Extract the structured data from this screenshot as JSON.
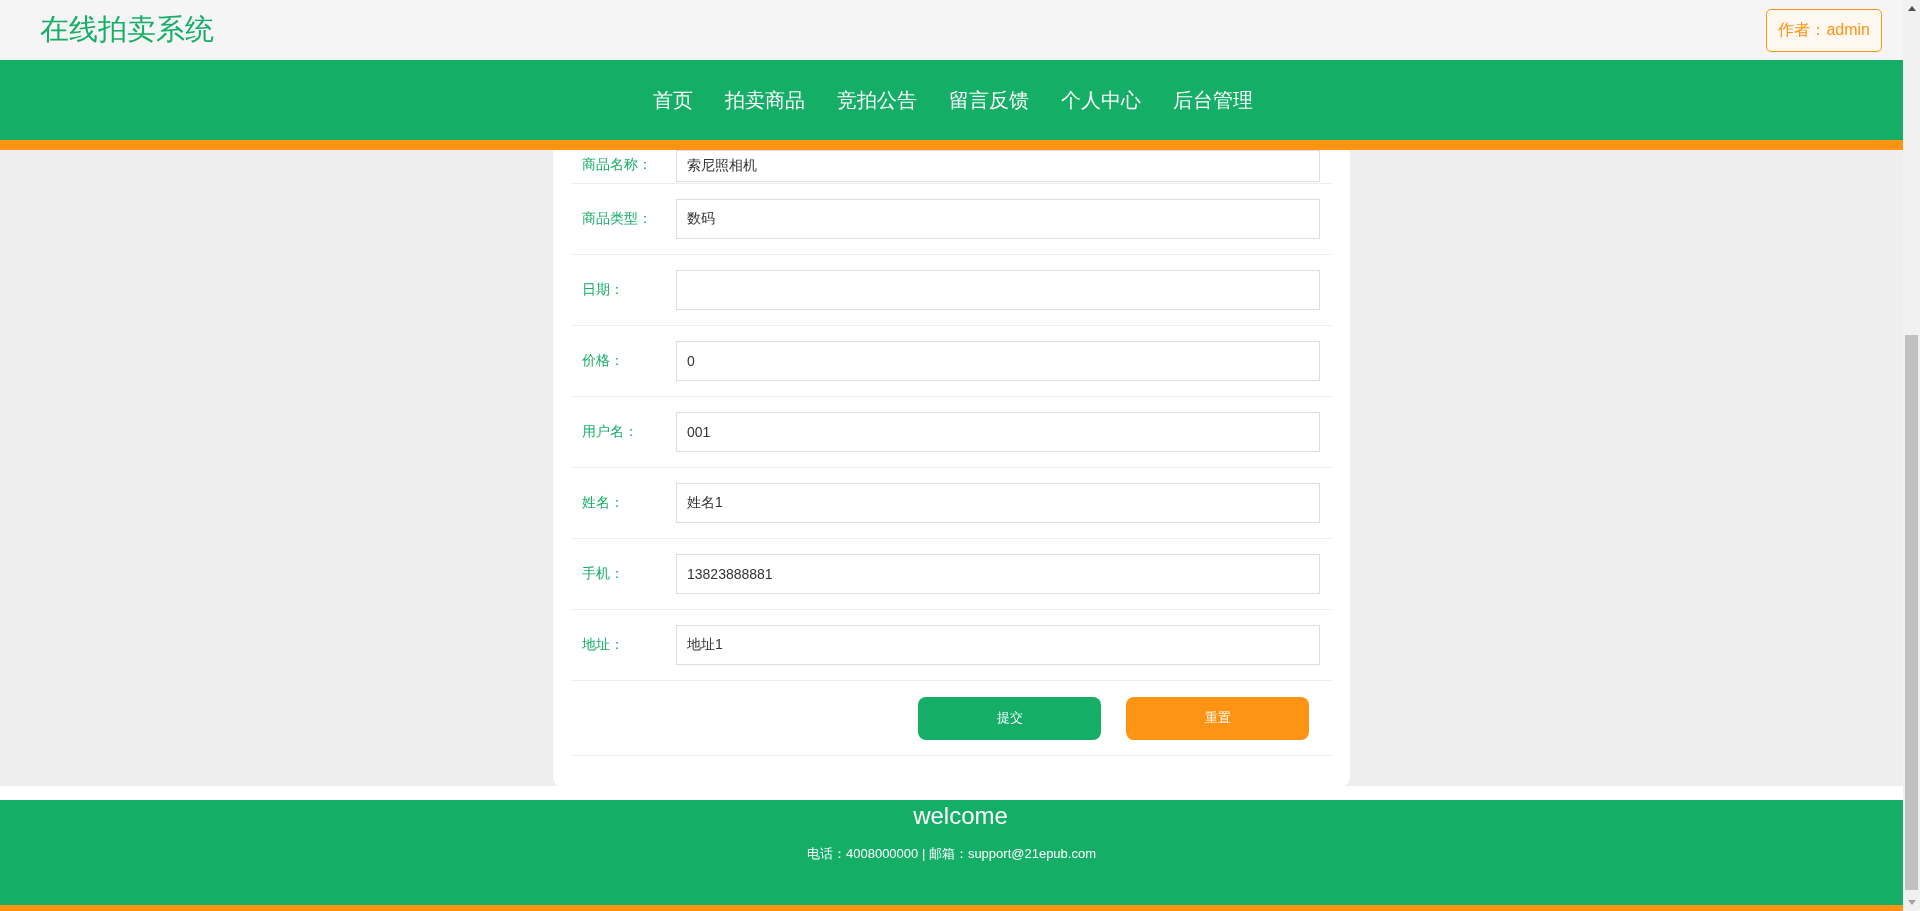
{
  "header": {
    "title": "在线拍卖系统",
    "author_badge": "作者：admin"
  },
  "nav": [
    {
      "label": "首页"
    },
    {
      "label": "拍卖商品"
    },
    {
      "label": "竞拍公告"
    },
    {
      "label": "留言反馈"
    },
    {
      "label": "个人中心"
    },
    {
      "label": "后台管理"
    }
  ],
  "form": {
    "fields": [
      {
        "label": "商品名称：",
        "value": "索尼照相机"
      },
      {
        "label": "商品类型：",
        "value": "数码"
      },
      {
        "label": "日期："
      },
      {
        "label": "价格：",
        "value": "0"
      },
      {
        "label": "用户名：",
        "value": "001"
      },
      {
        "label": "姓名：",
        "value": "姓名1"
      },
      {
        "label": "手机：",
        "value": "13823888881"
      },
      {
        "label": "地址：",
        "value": "地址1"
      }
    ],
    "buttons": [
      {
        "label": "提交",
        "kind": "submit"
      },
      {
        "label": "重置",
        "kind": "reset"
      }
    ]
  },
  "footer": {
    "title": "welcome",
    "contact": "电话：4008000000 | 邮箱：support@21epub.com"
  }
}
